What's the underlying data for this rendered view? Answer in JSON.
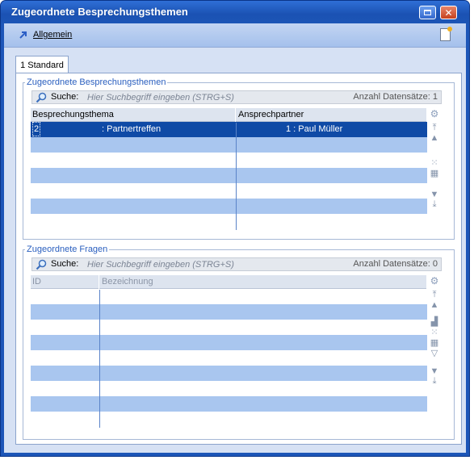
{
  "window": {
    "title": "Zugeordnete Besprechungsthemen"
  },
  "toolbar": {
    "allgemein_label": "Allgemein"
  },
  "tab": {
    "label": "1 Standard"
  },
  "group1": {
    "legend": "Zugeordnete Besprechungsthemen",
    "search": {
      "label": "Suche:",
      "placeholder": "Hier Suchbegriff eingeben (STRG+S)",
      "count_text": "Anzahl Datensätze: 1"
    },
    "columns": [
      "Besprechungsthema",
      "Ansprechpartner"
    ],
    "rows": [
      {
        "topic_id": "2",
        "topic_name": ": Partnertreffen",
        "contact": "1  : Paul Müller"
      }
    ]
  },
  "group2": {
    "legend": "Zugeordnete Fragen",
    "search": {
      "label": "Suche:",
      "placeholder": "Hier Suchbegriff eingeben (STRG+S)",
      "count_text": "Anzahl Datensätze: 0"
    },
    "columns": [
      "ID",
      "Bezeichnung"
    ]
  },
  "colors": {
    "title_bar": "#1b52b3",
    "selected_row": "#0f4aa6",
    "alt_row": "#a9c6ef",
    "legend": "#2a5fbf"
  }
}
